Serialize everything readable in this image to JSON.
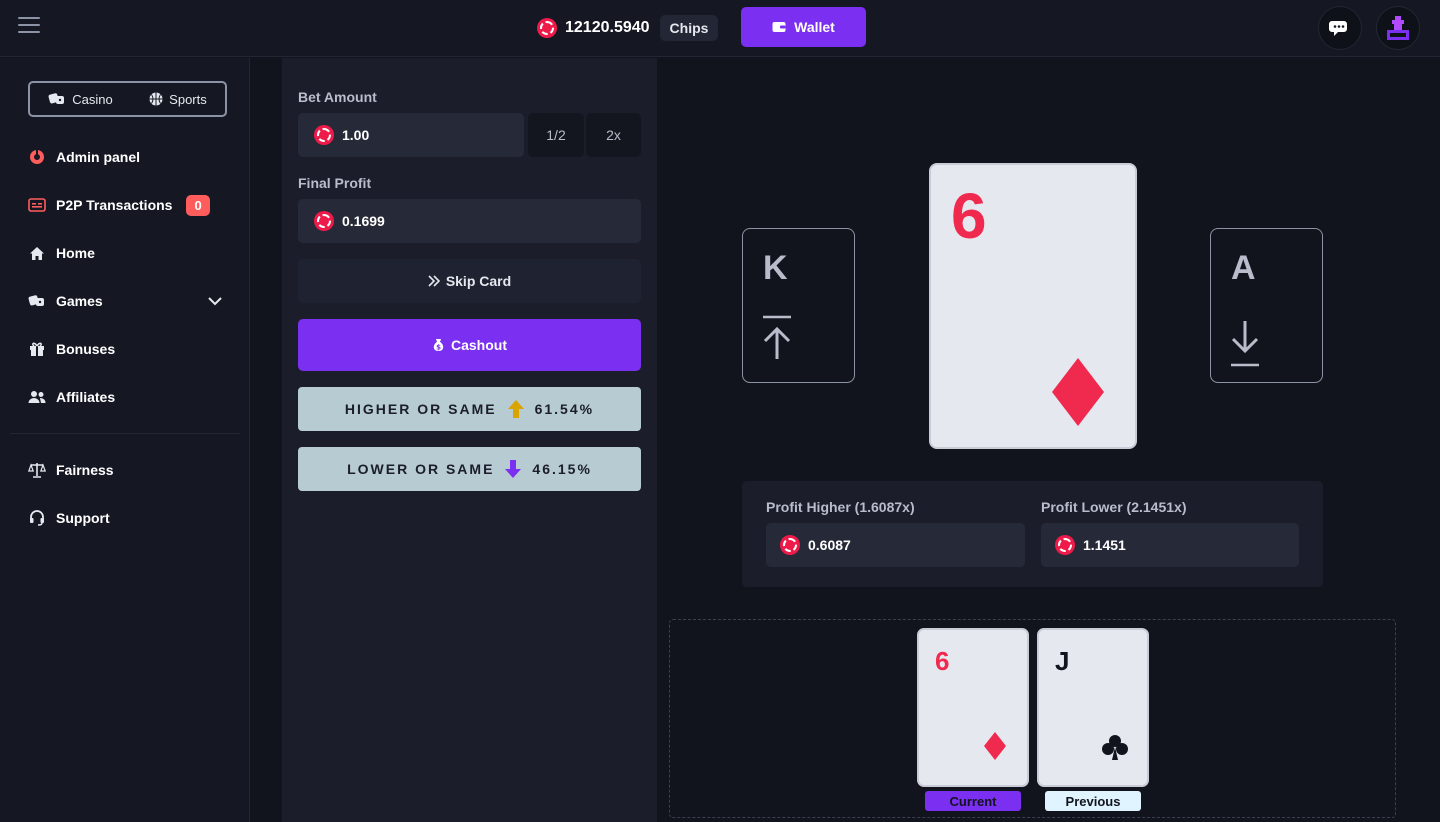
{
  "header": {
    "balance": "12120.5940",
    "currency": "Chips",
    "wallet_label": "Wallet"
  },
  "sidebar": {
    "modes": [
      {
        "label": "Casino",
        "icon": "dice-icon"
      },
      {
        "label": "Sports",
        "icon": "basketball-icon"
      }
    ],
    "items": [
      {
        "label": "Admin panel",
        "icon": "admin-icon"
      },
      {
        "label": "P2P Transactions",
        "icon": "p2p-icon",
        "badge": "0"
      },
      {
        "label": "Home",
        "icon": "home-icon"
      },
      {
        "label": "Games",
        "icon": "games-icon"
      },
      {
        "label": "Bonuses",
        "icon": "gift-icon"
      },
      {
        "label": "Affiliates",
        "icon": "users-icon"
      },
      {
        "label": "Fairness",
        "icon": "scale-icon"
      },
      {
        "label": "Support",
        "icon": "headset-icon"
      }
    ]
  },
  "bet": {
    "amount_label": "Bet Amount",
    "amount_value": "1.00",
    "half_label": "1/2",
    "double_label": "2x",
    "profit_label": "Final Profit",
    "profit_value": "0.1699",
    "skip_label": "Skip Card",
    "cashout_label": "Cashout",
    "higher_label": "HIGHER OR SAME",
    "higher_pct": "61.54%",
    "lower_label": "LOWER OR SAME",
    "lower_pct": "46.15%"
  },
  "game": {
    "left_card": "K",
    "current_rank": "6",
    "current_suit": "♦",
    "right_card": "A",
    "profit_higher_label": "Profit Higher (1.6087x)",
    "profit_higher_value": "0.6087",
    "profit_lower_label": "Profit Lower (2.1451x)",
    "profit_lower_value": "1.1451",
    "history": [
      {
        "rank": "6",
        "suit": "♦",
        "color": "#f0294f",
        "tag": "Current"
      },
      {
        "rank": "J",
        "suit": "♣",
        "color": "#12141d",
        "tag": "Previous"
      }
    ]
  },
  "colors": {
    "accent": "#7b2ff0",
    "chip": "#ee1b4a",
    "choice_bg": "#b7cbd3",
    "higher_arrow": "#d9a400",
    "lower_arrow": "#7b2ff0"
  }
}
